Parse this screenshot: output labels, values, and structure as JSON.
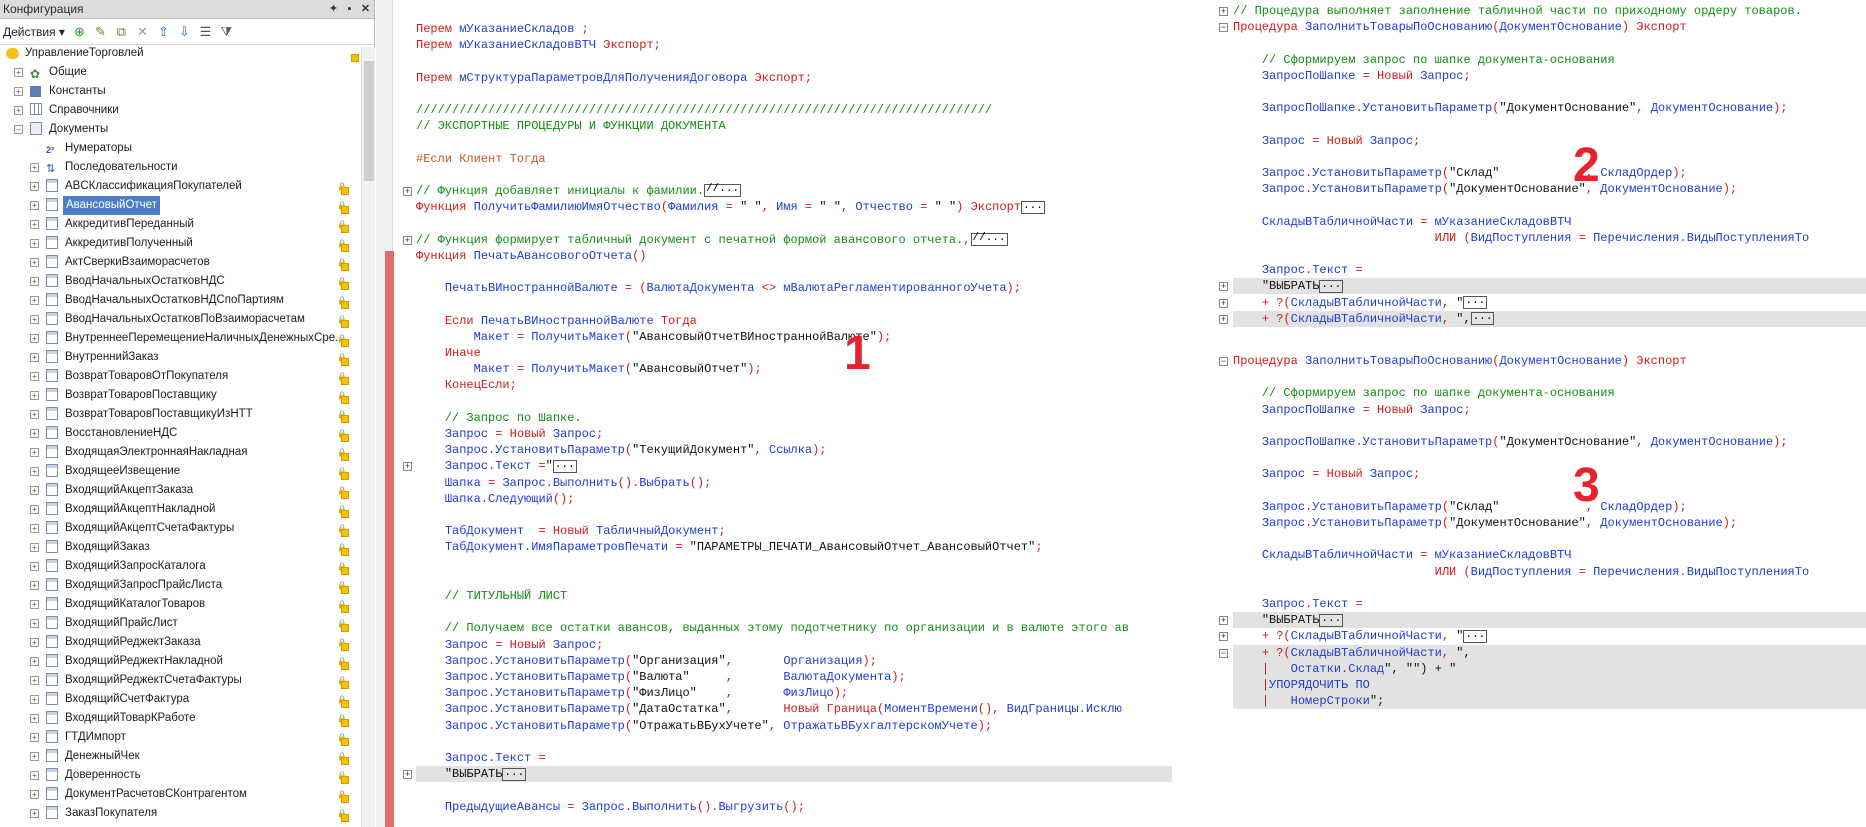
{
  "config_panel": {
    "title": "Конфигурация",
    "title_buttons": [
      "pin",
      "minimize",
      "close"
    ],
    "actions_label": "Действия ▾",
    "toolbar_icons": [
      "add-icon",
      "edit-icon",
      "copy-icon",
      "delete-icon",
      "move-up-icon",
      "move-down-icon",
      "sort-icon",
      "filter-icon"
    ],
    "tree": [
      {
        "label": "УправлениеТорговлей",
        "level": 0,
        "icon": "root-icon",
        "expand": "",
        "lock": true
      },
      {
        "label": "Общие",
        "level": 1,
        "icon": "common-icon",
        "expand": "+",
        "lock": false
      },
      {
        "label": "Константы",
        "level": 1,
        "icon": "constants-icon",
        "expand": "+",
        "lock": false
      },
      {
        "label": "Справочники",
        "level": 1,
        "icon": "catalogs-icon",
        "expand": "+",
        "lock": false
      },
      {
        "label": "Документы",
        "level": 1,
        "icon": "documents-icon",
        "expand": "−",
        "lock": false
      },
      {
        "label": "Нумераторы",
        "level": 2,
        "icon": "numerator-icon",
        "expand": "",
        "lock": false
      },
      {
        "label": "Последовательности",
        "level": 2,
        "icon": "sequence-icon",
        "expand": "+",
        "lock": false
      },
      {
        "label": "ABCКлассификацияПокупателей",
        "level": 2,
        "icon": "document-icon",
        "expand": "+",
        "lock": true
      },
      {
        "label": "АвансовыйОтчет",
        "level": 2,
        "icon": "document-icon",
        "expand": "+",
        "lock": true,
        "selected": true
      },
      {
        "label": "АккредитивПереданный",
        "level": 2,
        "icon": "document-icon",
        "expand": "+",
        "lock": true
      },
      {
        "label": "АккредитивПолученный",
        "level": 2,
        "icon": "document-icon",
        "expand": "+",
        "lock": true
      },
      {
        "label": "АктСверкиВзаиморасчетов",
        "level": 2,
        "icon": "document-icon",
        "expand": "+",
        "lock": true
      },
      {
        "label": "ВводНачальныхОстатковНДС",
        "level": 2,
        "icon": "document-icon",
        "expand": "+",
        "lock": true
      },
      {
        "label": "ВводНачальныхОстатковНДСпоПартиям",
        "level": 2,
        "icon": "document-icon",
        "expand": "+",
        "lock": true
      },
      {
        "label": "ВводНачальныхОстатковПоВзаиморасчетам",
        "level": 2,
        "icon": "document-icon",
        "expand": "+",
        "lock": true
      },
      {
        "label": "ВнутреннееПеремещениеНаличныхДенежныхСре...",
        "level": 2,
        "icon": "document-icon",
        "expand": "+",
        "lock": true
      },
      {
        "label": "ВнутреннийЗаказ",
        "level": 2,
        "icon": "document-icon",
        "expand": "+",
        "lock": true
      },
      {
        "label": "ВозвратТоваровОтПокупателя",
        "level": 2,
        "icon": "document-icon",
        "expand": "+",
        "lock": true
      },
      {
        "label": "ВозвратТоваровПоставщику",
        "level": 2,
        "icon": "document-icon",
        "expand": "+",
        "lock": true
      },
      {
        "label": "ВозвратТоваровПоставщикуИзНТТ",
        "level": 2,
        "icon": "document-icon",
        "expand": "+",
        "lock": true
      },
      {
        "label": "ВосстановлениеНДС",
        "level": 2,
        "icon": "document-icon",
        "expand": "+",
        "lock": true
      },
      {
        "label": "ВходящаяЭлектроннаяНакладная",
        "level": 2,
        "icon": "document-icon",
        "expand": "+",
        "lock": true
      },
      {
        "label": "ВходящееИзвещение",
        "level": 2,
        "icon": "document-icon",
        "expand": "+",
        "lock": true
      },
      {
        "label": "ВходящийАкцептЗаказа",
        "level": 2,
        "icon": "document-icon",
        "expand": "+",
        "lock": true
      },
      {
        "label": "ВходящийАкцептНакладной",
        "level": 2,
        "icon": "document-icon",
        "expand": "+",
        "lock": true
      },
      {
        "label": "ВходящийАкцептСчетаФактуры",
        "level": 2,
        "icon": "document-icon",
        "expand": "+",
        "lock": true
      },
      {
        "label": "ВходящийЗаказ",
        "level": 2,
        "icon": "document-icon",
        "expand": "+",
        "lock": true
      },
      {
        "label": "ВходящийЗапросКаталога",
        "level": 2,
        "icon": "document-icon",
        "expand": "+",
        "lock": true
      },
      {
        "label": "ВходящийЗапросПрайсЛиста",
        "level": 2,
        "icon": "document-icon",
        "expand": "+",
        "lock": true
      },
      {
        "label": "ВходящийКаталогТоваров",
        "level": 2,
        "icon": "document-icon",
        "expand": "+",
        "lock": true
      },
      {
        "label": "ВходящийПрайсЛист",
        "level": 2,
        "icon": "document-icon",
        "expand": "+",
        "lock": true
      },
      {
        "label": "ВходящийРеджектЗаказа",
        "level": 2,
        "icon": "document-icon",
        "expand": "+",
        "lock": true
      },
      {
        "label": "ВходящийРеджектНакладной",
        "level": 2,
        "icon": "document-icon",
        "expand": "+",
        "lock": true
      },
      {
        "label": "ВходящийРеджектСчетаФактуры",
        "level": 2,
        "icon": "document-icon",
        "expand": "+",
        "lock": true
      },
      {
        "label": "ВходящийСчетФактура",
        "level": 2,
        "icon": "document-icon",
        "expand": "+",
        "lock": true
      },
      {
        "label": "ВходящийТоварКРаботе",
        "level": 2,
        "icon": "document-icon",
        "expand": "+",
        "lock": true
      },
      {
        "label": "ГТДИмпорт",
        "level": 2,
        "icon": "document-icon",
        "expand": "+",
        "lock": true
      },
      {
        "label": "ДенежныйЧек",
        "level": 2,
        "icon": "document-icon",
        "expand": "+",
        "lock": true
      },
      {
        "label": "Доверенность",
        "level": 2,
        "icon": "document-icon",
        "expand": "+",
        "lock": true
      },
      {
        "label": "ДокументРасчетовСКонтрагентом",
        "level": 2,
        "icon": "document-icon",
        "expand": "+",
        "lock": true
      },
      {
        "label": "ЗаказПокупателя",
        "level": 2,
        "icon": "document-icon",
        "expand": "+",
        "lock": true
      }
    ]
  },
  "main_code": [
    {
      "text": "Перем мУказаниеСкладов ;"
    },
    {
      "text": "Перем мУказаниеСкладовВТЧ Экспорт;"
    },
    {
      "text": ""
    },
    {
      "text": "Перем мСтруктураПараметровДляПолученияДоговора Экспорт;"
    },
    {
      "text": ""
    },
    {
      "text": "////////////////////////////////////////////////////////////////////////////////",
      "kind": "comment"
    },
    {
      "text": "// ЭКСПОРТНЫЕ ПРОЦЕДУРЫ И ФУНКЦИИ ДОКУМЕНТА",
      "kind": "comment"
    },
    {
      "text": ""
    },
    {
      "text": "#Если Клиент Тогда",
      "kind": "pre"
    },
    {
      "text": ""
    },
    {
      "text": "// Функция добавляет инициалы к фамилии.",
      "kind": "comment",
      "fold": true,
      "dots": "//..."
    },
    {
      "text": "Функция ПолучитьФамилиюИмяОтчество(Фамилия = \" \", Имя = \" \", Отчество = \" \") Экспорт",
      "dots": "..."
    },
    {
      "text": ""
    },
    {
      "text": "// Функция формирует табличный документ с печатной формой авансового отчета.,",
      "kind": "comment",
      "fold": true,
      "dots": "//..."
    },
    {
      "text": "Функция ПечатьАвансовогоОтчета()"
    },
    {
      "text": ""
    },
    {
      "text": "    ПечатьВИностраннойВалюте = (ВалютаДокумента <> мВалютаРегламентированногоУчета);"
    },
    {
      "text": ""
    },
    {
      "text": "    Если ПечатьВИностраннойВалюте Тогда"
    },
    {
      "text": "        Макет = ПолучитьМакет(\"АвансовыйОтчетВИностраннойВалюте\");"
    },
    {
      "text": "    Иначе"
    },
    {
      "text": "        Макет = ПолучитьМакет(\"АвансовыйОтчет\");"
    },
    {
      "text": "    КонецЕсли;"
    },
    {
      "text": ""
    },
    {
      "text": "    // Запрос по Шапке.",
      "kind": "comment"
    },
    {
      "text": "    Запрос = Новый Запрос;"
    },
    {
      "text": "    Запрос.УстановитьПараметр(\"ТекущийДокумент\", Ссылка);"
    },
    {
      "text": "    Запрос.Текст =\"",
      "fold": true,
      "dots": "..."
    },
    {
      "text": "    Шапка = Запрос.Выполнить().Выбрать();"
    },
    {
      "text": "    Шапка.Следующий();"
    },
    {
      "text": ""
    },
    {
      "text": "    ТабДокумент  = Новый ТабличныйДокумент;"
    },
    {
      "text": "    ТабДокумент.ИмяПараметровПечати = \"ПАРАМЕТРЫ_ПЕЧАТИ_АвансовыйОтчет_АвансовыйОтчет\";"
    },
    {
      "text": ""
    },
    {
      "text": ""
    },
    {
      "text": "    // ТИТУЛЬНЫЙ ЛИСТ",
      "kind": "comment"
    },
    {
      "text": ""
    },
    {
      "text": "    // Получаем все остатки авансов, выданных этому подотчетнику по организации и в валюте этого ав",
      "kind": "comment"
    },
    {
      "text": "    Запрос = Новый Запрос;"
    },
    {
      "text": "    Запрос.УстановитьПараметр(\"Организация\",       Организация);"
    },
    {
      "text": "    Запрос.УстановитьПараметр(\"Валюта\"     ,       ВалютаДокумента);"
    },
    {
      "text": "    Запрос.УстановитьПараметр(\"ФизЛицо\"    ,       ФизЛицо);"
    },
    {
      "text": "    Запрос.УстановитьПараметр(\"ДатаОстатка\",       Новый Граница(МоментВремени(), ВидГраницы.Исклю"
    },
    {
      "text": "    Запрос.УстановитьПараметр(\"ОтражатьВБухУчете\", ОтражатьВБухгалтерскомУчете);"
    },
    {
      "text": ""
    },
    {
      "text": "    Запрос.Текст ="
    },
    {
      "text": "    \"ВЫБРАТЬ",
      "fold": true,
      "dots": "...",
      "hl": true
    },
    {
      "text": ""
    },
    {
      "text": "    ПредыдущиеАвансы = Запрос.Выполнить().Выгрузить();"
    },
    {
      "text": ""
    },
    {
      "text": "    ..."
    }
  ],
  "panel2": [
    {
      "text": "// Процедура выполняет заполнение табличной части по приходному ордеру товаров.",
      "kind": "comment",
      "fold": "+"
    },
    {
      "text": "Процедура ЗаполнитьТоварыПоОснованию(ДокументОснование) Экспорт",
      "fold": "−"
    },
    {
      "text": ""
    },
    {
      "text": "    // Сформируем запрос по шапке документа-основания",
      "kind": "comment"
    },
    {
      "text": "    ЗапросПоШапке = Новый Запрос;"
    },
    {
      "text": ""
    },
    {
      "text": "    ЗапросПоШапке.УстановитьПараметр(\"ДокументОснование\", ДокументОснование);"
    },
    {
      "text": ""
    },
    {
      "text": "    Запрос = Новый Запрос;"
    },
    {
      "text": ""
    },
    {
      "text": "    Запрос.УстановитьПараметр(\"Склад\"            , СкладОрдер);"
    },
    {
      "text": "    Запрос.УстановитьПараметр(\"ДокументОснование\", ДокументОснование);"
    },
    {
      "text": ""
    },
    {
      "text": "    СкладыВТабличнойЧасти = мУказаниеСкладовВТЧ"
    },
    {
      "text": "                            ИЛИ (ВидПоступления = Перечисления.ВидыПоступленияТо"
    },
    {
      "text": ""
    },
    {
      "text": "    Запрос.Текст ="
    },
    {
      "text": "    \"ВЫБРАТЬ",
      "fold": "+",
      "dots": "...",
      "hl": true
    },
    {
      "text": "    + ?(СкладыВТабличнойЧасти, \"",
      "fold": "+",
      "dots": "..."
    },
    {
      "text": "    + ?(СкладыВТабличнойЧасти, \",",
      "fold": "+",
      "dots": "...",
      "hl": true
    }
  ],
  "panel3": [
    {
      "text": "Процедура ЗаполнитьТоварыПоОснованию(ДокументОснование) Экспорт",
      "fold": "−"
    },
    {
      "text": ""
    },
    {
      "text": "    // Сформируем запрос по шапке документа-основания",
      "kind": "comment"
    },
    {
      "text": "    ЗапросПоШапке = Новый Запрос;"
    },
    {
      "text": ""
    },
    {
      "text": "    ЗапросПоШапке.УстановитьПараметр(\"ДокументОснование\", ДокументОснование);"
    },
    {
      "text": ""
    },
    {
      "text": "    Запрос = Новый Запрос;"
    },
    {
      "text": ""
    },
    {
      "text": "    Запрос.УстановитьПараметр(\"Склад\"            , СкладОрдер);"
    },
    {
      "text": "    Запрос.УстановитьПараметр(\"ДокументОснование\", ДокументОснование);"
    },
    {
      "text": ""
    },
    {
      "text": "    СкладыВТабличнойЧасти = мУказаниеСкладовВТЧ"
    },
    {
      "text": "                            ИЛИ (ВидПоступления = Перечисления.ВидыПоступленияТо"
    },
    {
      "text": ""
    },
    {
      "text": "    Запрос.Текст ="
    },
    {
      "text": "    \"ВЫБРАТЬ",
      "fold": "+",
      "dots": "...",
      "hl": true
    },
    {
      "text": "    + ?(СкладыВТабличнойЧасти, \"",
      "fold": "+",
      "dots": "..."
    },
    {
      "text": "    + ?(СкладыВТабличнойЧасти, \",",
      "fold": "−",
      "hl": true
    },
    {
      "text": "    |   Остатки.Склад\", \"\") + \"",
      "hl": true
    },
    {
      "text": "    |УПОРЯДОЧИТЬ ПО",
      "hl": true
    },
    {
      "text": "    |   НомерСтроки\";",
      "hl": true
    }
  ],
  "markers": {
    "one": "1",
    "two": "2",
    "three": "3"
  }
}
